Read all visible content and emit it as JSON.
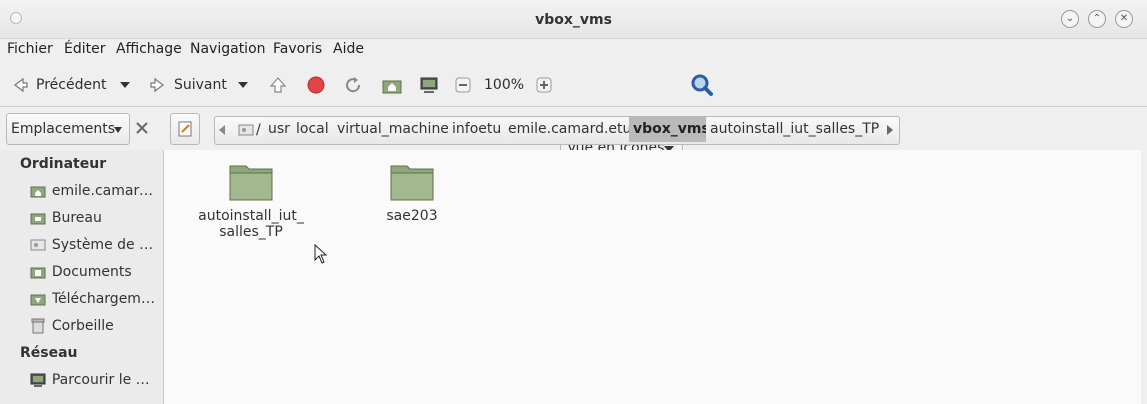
{
  "window": {
    "title": "vbox_vms"
  },
  "menu": [
    "Fichier",
    "Éditer",
    "Affichage",
    "Navigation",
    "Favoris",
    "Aide"
  ],
  "toolbar": {
    "back_label": "Précédent",
    "forward_label": "Suivant",
    "zoom": "100%",
    "view_mode": "Vue en icônes"
  },
  "locationbar": {
    "places_label": "Emplacements",
    "root": "/",
    "crumbs": [
      "usr",
      "local",
      "virtual_machine",
      "infoetu",
      "emile.camard.etu",
      "vbox_vms",
      "autoinstall_iut_salles_TP"
    ],
    "active_crumb": "vbox_vms"
  },
  "sidebar": {
    "section1": "Ordinateur",
    "items1": [
      "emile.camard.etu",
      "Bureau",
      "Système de fichiers",
      "Documents",
      "Téléchargements",
      "Corbeille"
    ],
    "section2": "Réseau",
    "items2": [
      "Parcourir le réseau"
    ]
  },
  "files": [
    {
      "line1": "autoinstall_iut_",
      "line2": "salles_TP"
    },
    {
      "line1": "sae203",
      "line2": ""
    }
  ],
  "colors": {
    "folder": "#8fa77a",
    "active_crumb": "#b9b9b9",
    "stop": "#e04444",
    "search": "#2a5ea8"
  }
}
